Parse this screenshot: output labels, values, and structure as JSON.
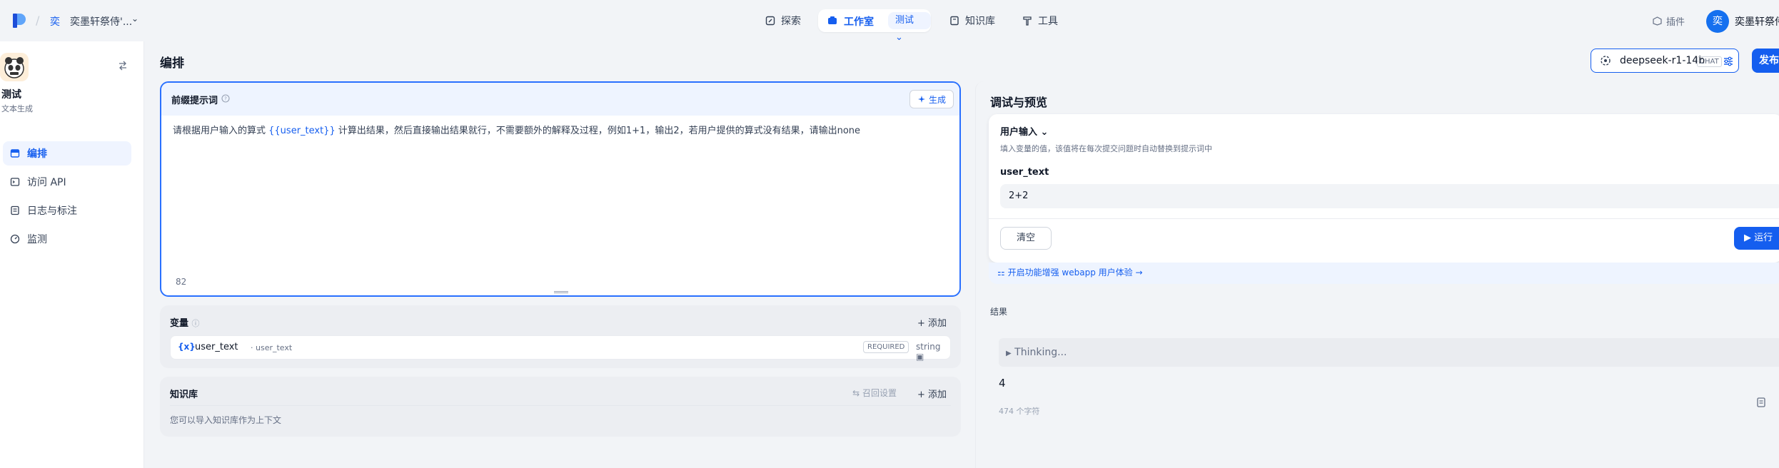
{
  "topbar": {
    "app_char": "奕",
    "app_name": "奕墨轩祭侍'...",
    "nav": {
      "explore": "探索",
      "studio": "工作室",
      "studio_sub": "测试",
      "knowledge": "知识库",
      "tools": "工具"
    },
    "plugin": "插件",
    "avatar_char": "奕",
    "username": "奕墨轩祭侍"
  },
  "sidebar": {
    "app_title": "测试",
    "app_type": "文本生成",
    "items": [
      {
        "label": "编排",
        "icon": "layout-icon",
        "active": true
      },
      {
        "label": "访问 API",
        "icon": "terminal-icon",
        "active": false
      },
      {
        "label": "日志与标注",
        "icon": "log-icon",
        "active": false
      },
      {
        "label": "监测",
        "icon": "monitor-icon",
        "active": false
      }
    ]
  },
  "main": {
    "title": "编排",
    "model": {
      "name": "deepseek-r1-14b",
      "badge": "CHAT"
    },
    "publish": "发布"
  },
  "prompt": {
    "title": "前缀提示词",
    "generate": "生成",
    "text_before": "请根据用户输入的算式 ",
    "text_var": "{{user_text}}",
    "text_after": " 计算出结果，然后直接输出结果就行，不需要额外的解释及过程，例如1+1，输出2，若用户提供的算式没有结果，请输出none",
    "char_count": "82"
  },
  "variables": {
    "title": "变量",
    "add": "添加",
    "rows": [
      {
        "key": "user_text",
        "name": "user_text",
        "required": "REQUIRED",
        "type": "string"
      }
    ]
  },
  "knowledge": {
    "title": "知识库",
    "recall": "召回设置",
    "add": "添加",
    "desc": "您可以导入知识库作为上下文"
  },
  "debug": {
    "title": "调试与预览",
    "user_input": "用户输入",
    "input_desc": "填入变量的值，该值将在每次提交问题时自动替换到提示词中",
    "var_label": "user_text",
    "var_value": "2+2",
    "clear": "清空",
    "run": "运行",
    "webapp": "开启功能增强 webapp 用户体验",
    "result_label": "结果",
    "thinking": "Thinking...",
    "result": "4",
    "result_chars": "474 个字符"
  },
  "colors": {
    "accent": "#155eef",
    "background": "#f2f4f7"
  }
}
